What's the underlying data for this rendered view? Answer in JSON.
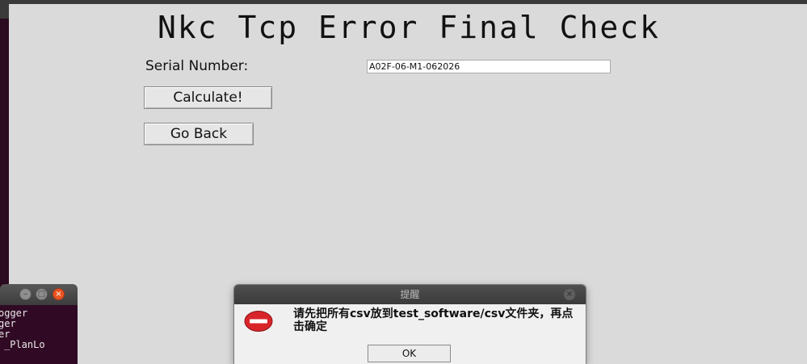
{
  "main_window": {
    "title": "Nkc Tcp Error Final Check",
    "serial_label": "Serial Number:",
    "serial_value": "A02F-06-M1-062026",
    "calculate_label": "Calculate!",
    "go_back_label": "Go Back"
  },
  "terminal": {
    "lines": [
      "ogger",
      "ger",
      "er",
      "_PlanLo"
    ]
  },
  "dialog": {
    "title": "提醒",
    "message": "请先把所有csv放到test_software/csv文件夹，再点击确定",
    "ok_label": "OK",
    "icon": "error-icon"
  },
  "colors": {
    "window_bg": "#dadada",
    "terminal_bg": "#300a24",
    "close_orange": "#e95420",
    "error_red": "#d8252a"
  }
}
